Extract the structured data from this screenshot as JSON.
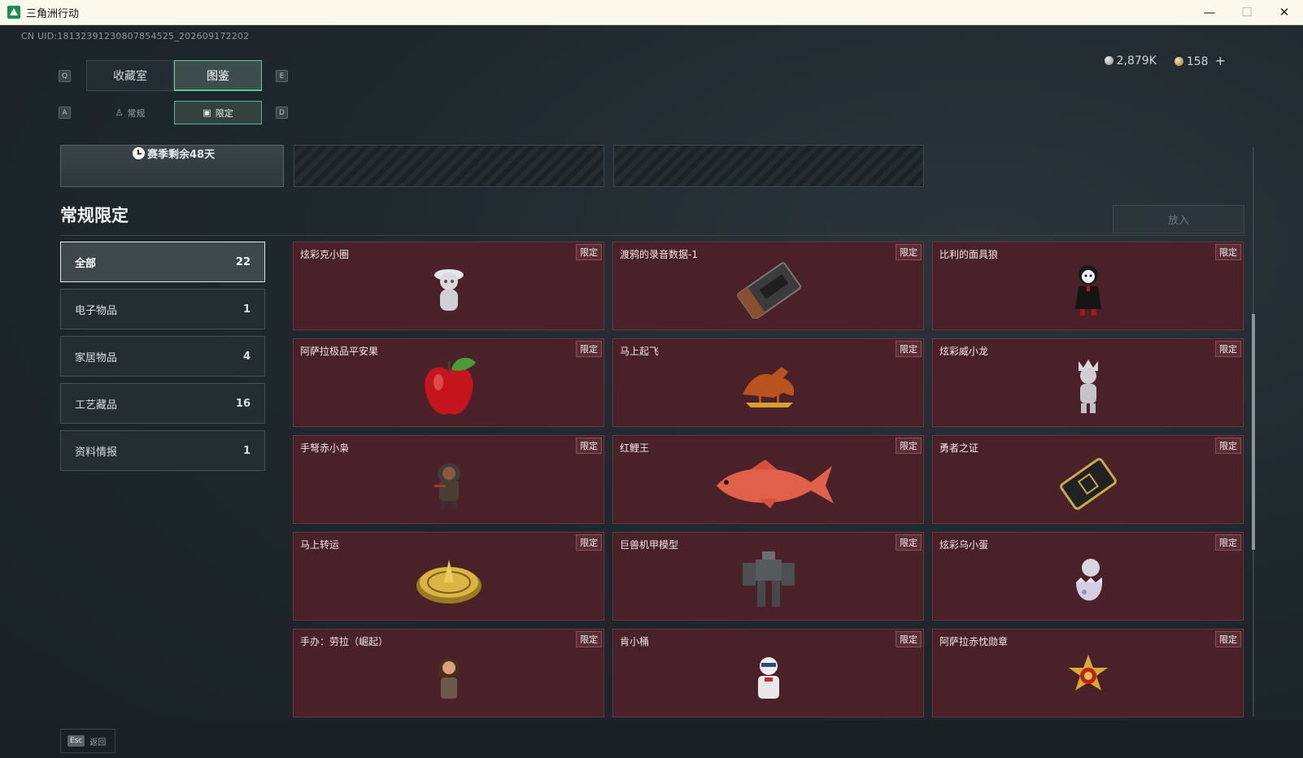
{
  "window": {
    "title": "三角洲行动",
    "minimize": "—",
    "maximize": "☐",
    "close": "✕"
  },
  "uid": "CN UID:181323912308078545​25_202609172202",
  "currency": {
    "silver": "2,879K",
    "gold": "158",
    "plus": "+"
  },
  "keys": {
    "q": "Q",
    "e": "E",
    "a": "A",
    "d": "D"
  },
  "tabs": {
    "collection": "收藏室",
    "catalog": "图鉴"
  },
  "subtabs": {
    "regular": "常规",
    "limited": "限定"
  },
  "season": {
    "text": "赛季剩余48天"
  },
  "section": {
    "title": "常规限定",
    "put_button": "放入"
  },
  "categories": [
    {
      "label": "全部",
      "count": "22"
    },
    {
      "label": "电子物品",
      "count": "1"
    },
    {
      "label": "家居物品",
      "count": "4"
    },
    {
      "label": "工艺藏品",
      "count": "16"
    },
    {
      "label": "资料情报",
      "count": "1"
    }
  ],
  "items": [
    {
      "name": "炫彩克小圈",
      "tag": "限定",
      "icon": "figurine-icon"
    },
    {
      "name": "渡鸦的录音数据-1",
      "tag": "限定",
      "icon": "cassette-tape-icon"
    },
    {
      "name": "比利的面具狼",
      "tag": "限定",
      "icon": "puppet-figure-icon"
    },
    {
      "name": "阿萨拉极品平安果",
      "tag": "限定",
      "icon": "apple-icon"
    },
    {
      "name": "马上起飞",
      "tag": "限定",
      "icon": "horse-statue-icon"
    },
    {
      "name": "炫彩威小龙",
      "tag": "限定",
      "icon": "figurine-icon"
    },
    {
      "name": "手弩赤小枭",
      "tag": "限定",
      "icon": "hooded-figure-icon"
    },
    {
      "name": "红鲤王",
      "tag": "限定",
      "icon": "carp-fish-icon"
    },
    {
      "name": "勇者之证",
      "tag": "限定",
      "icon": "badge-plate-icon"
    },
    {
      "name": "马上转运",
      "tag": "限定",
      "icon": "golden-compass-icon"
    },
    {
      "name": "巨兽机甲模型",
      "tag": "限定",
      "icon": "mech-model-icon"
    },
    {
      "name": "炫彩乌小蛋",
      "tag": "限定",
      "icon": "egg-figurine-icon"
    },
    {
      "name": "手办：劳拉（崛起）",
      "tag": "限定",
      "icon": "figurine-icon"
    },
    {
      "name": "肯小桶",
      "tag": "限定",
      "icon": "bucket-figure-icon"
    },
    {
      "name": "阿萨拉赤忱勋章",
      "tag": "限定",
      "icon": "medal-icon"
    }
  ],
  "footer": {
    "esc": "Esc",
    "back": "返回"
  },
  "colors": {
    "accent": "#55c590",
    "card": "#4a2128",
    "card_border": "#6e3a43"
  }
}
